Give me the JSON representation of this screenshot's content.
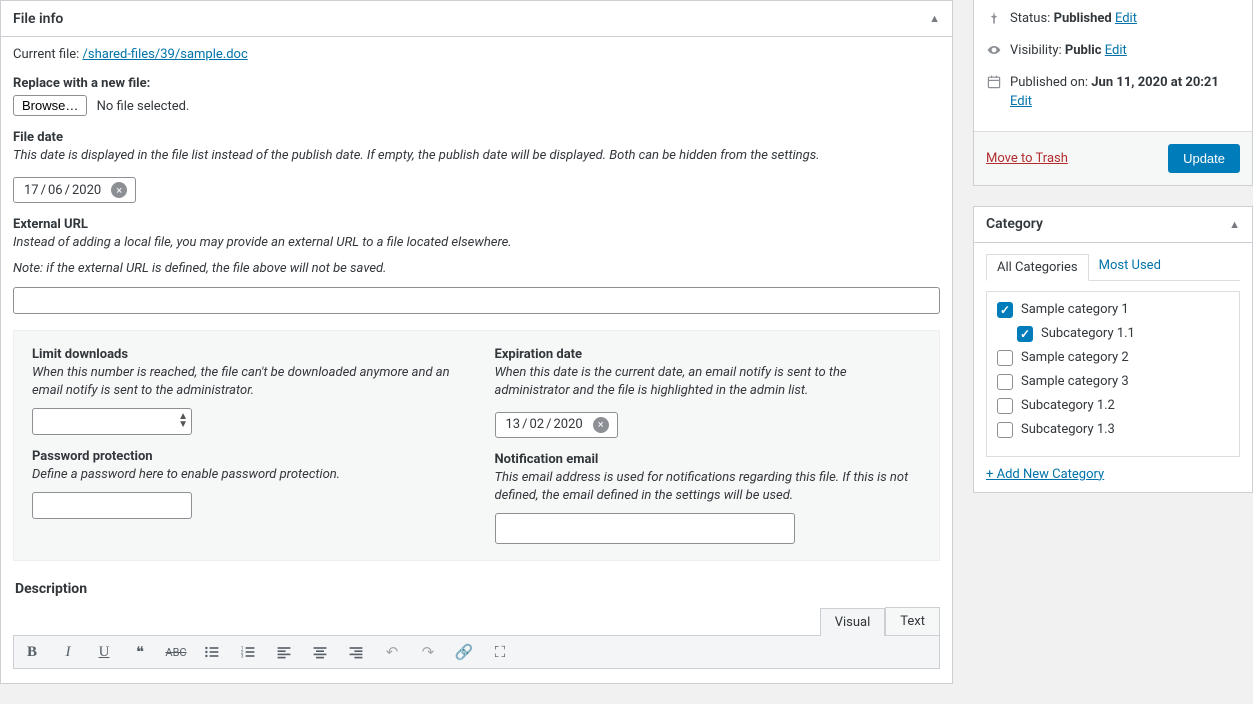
{
  "fileinfo": {
    "panel_title": "File info",
    "current_file_label": "Current file:",
    "current_file_path": "/shared-files/39/sample.doc",
    "replace_label": "Replace with a new file:",
    "browse_label": "Browse…",
    "no_file_selected": "No file selected.",
    "file_date_label": "File date",
    "file_date_desc": "This date is displayed in the file list instead of the publish date. If empty, the publish date will be displayed. Both can be hidden from the settings.",
    "file_date_day": "17",
    "file_date_month": "06",
    "file_date_year": "2020",
    "ext_url_label": "External URL",
    "ext_url_desc1": "Instead of adding a local file, you may provide an external URL to a file located elsewhere.",
    "ext_url_desc2": "Note: if the external URL is defined, the file above will not be saved.",
    "ext_url_value": "",
    "limit_label": "Limit downloads",
    "limit_desc": "When this number is reached, the file can't be downloaded anymore and an email notify is sent to the administrator.",
    "limit_value": "",
    "pw_label": "Password protection",
    "pw_desc": "Define a password here to enable password protection.",
    "pw_value": "",
    "exp_label": "Expiration date",
    "exp_desc": "When this date is the current date, an email notify is sent to the administrator and the file is highlighted in the admin list.",
    "exp_day": "13",
    "exp_month": "02",
    "exp_year": "2020",
    "notif_label": "Notification email",
    "notif_desc": "This email address is used for notifications regarding this file. If this is not defined, the email defined in the settings will be used.",
    "notif_value": "",
    "description_label": "Description"
  },
  "editor": {
    "tab_visual": "Visual",
    "tab_text": "Text"
  },
  "publish": {
    "status_label": "Status:",
    "status_value": "Published",
    "visibility_label": "Visibility:",
    "visibility_value": "Public",
    "published_label": "Published on:",
    "published_value": "Jun 11, 2020 at 20:21",
    "edit": "Edit",
    "trash": "Move to Trash",
    "update": "Update"
  },
  "category": {
    "panel_title": "Category",
    "tab_all": "All Categories",
    "tab_most": "Most Used",
    "items": [
      {
        "label": "Sample category 1",
        "checked": true,
        "indent": false
      },
      {
        "label": "Subcategory 1.1",
        "checked": true,
        "indent": true
      },
      {
        "label": "Sample category 2",
        "checked": false,
        "indent": false
      },
      {
        "label": "Sample category 3",
        "checked": false,
        "indent": false
      },
      {
        "label": "Subcategory 1.2",
        "checked": false,
        "indent": false
      },
      {
        "label": "Subcategory 1.3",
        "checked": false,
        "indent": false
      }
    ],
    "add_new": "+ Add New Category"
  }
}
